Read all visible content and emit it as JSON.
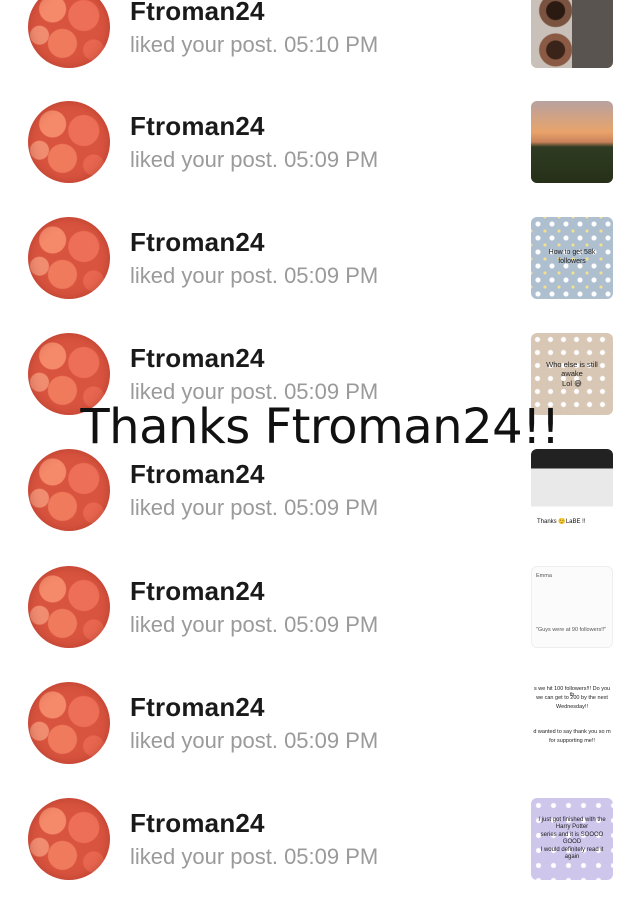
{
  "notifications": [
    {
      "user": "Ftroman24",
      "action": "liked your post. 05:10 PM",
      "thumb": {
        "type": "eyes",
        "lines": []
      }
    },
    {
      "user": "Ftroman24",
      "action": "liked your post. 05:09 PM",
      "thumb": {
        "type": "sunset",
        "lines": []
      }
    },
    {
      "user": "Ftroman24",
      "action": "liked your post. 05:09 PM",
      "thumb": {
        "type": "daisy",
        "lines": [
          "How to get 58k followers"
        ]
      }
    },
    {
      "user": "Ftroman24",
      "action": "liked your post. 05:09 PM",
      "thumb": {
        "type": "beige",
        "lines": [
          "Who else is still awake",
          "Lol 😅"
        ]
      }
    },
    {
      "user": "Ftroman24",
      "action": "liked your post. 05:09 PM",
      "thumb": {
        "type": "screens",
        "lines": [
          "Thanks ☺️LaBE !!"
        ]
      }
    },
    {
      "user": "Ftroman24",
      "action": "liked your post. 05:09 PM",
      "thumb": {
        "type": "post",
        "lines": [
          "Emma",
          "\"Guys were at 90 followers!!\""
        ]
      }
    },
    {
      "user": "Ftroman24",
      "action": "liked your post. 05:09 PM",
      "thumb": {
        "type": "white",
        "lines": [
          "s we hit 100 followers!!! Do you th",
          "we can get to 200 by the next",
          "Wednesday!!",
          "d wanted to say thank you so m",
          "for supporting me!!"
        ]
      }
    },
    {
      "user": "Ftroman24",
      "action": "liked your post. 05:09 PM",
      "thumb": {
        "type": "purple",
        "lines": [
          "I just got finished with the Harry Potter",
          "series and it is SOOOO GOOD",
          "I would definitely read it again"
        ]
      }
    }
  ],
  "overlay_text": "Thanks Ftroman24!!"
}
